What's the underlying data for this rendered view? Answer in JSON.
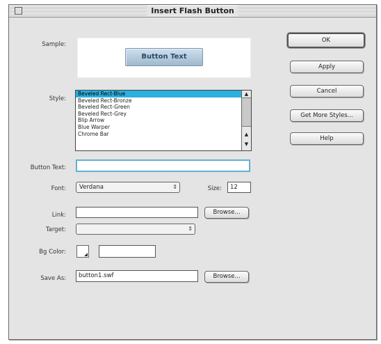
{
  "window": {
    "title": "Insert Flash Button"
  },
  "labels": {
    "sample": "Sample:",
    "style": "Style:",
    "button_text": "Button Text:",
    "font": "Font:",
    "size": "Size:",
    "link": "Link:",
    "target": "Target:",
    "bg_color": "Bg Color:",
    "save_as": "Save As:"
  },
  "sample": {
    "button_label": "Button Text"
  },
  "styles": [
    "Beveled Rect-Blue",
    "Beveled Rect-Bronze",
    "Beveled Rect-Green",
    "Beveled Rect-Grey",
    "Blip Arrow",
    "Blue Warper",
    "Chrome Bar"
  ],
  "selected_style_index": 0,
  "fields": {
    "button_text": "",
    "font": "Verdana",
    "size": "12",
    "link": "",
    "target": "",
    "bg_color": "",
    "save_as": "button1.swf"
  },
  "buttons": {
    "ok": "OK",
    "apply": "Apply",
    "cancel": "Cancel",
    "get_more_styles": "Get More Styles...",
    "help": "Help",
    "browse_link": "Browse...",
    "browse_save": "Browse..."
  },
  "colors": {
    "selection": "#2bb0e0",
    "focus_ring": "#5fb0d8",
    "dialog_bg": "#e4e4e4"
  }
}
